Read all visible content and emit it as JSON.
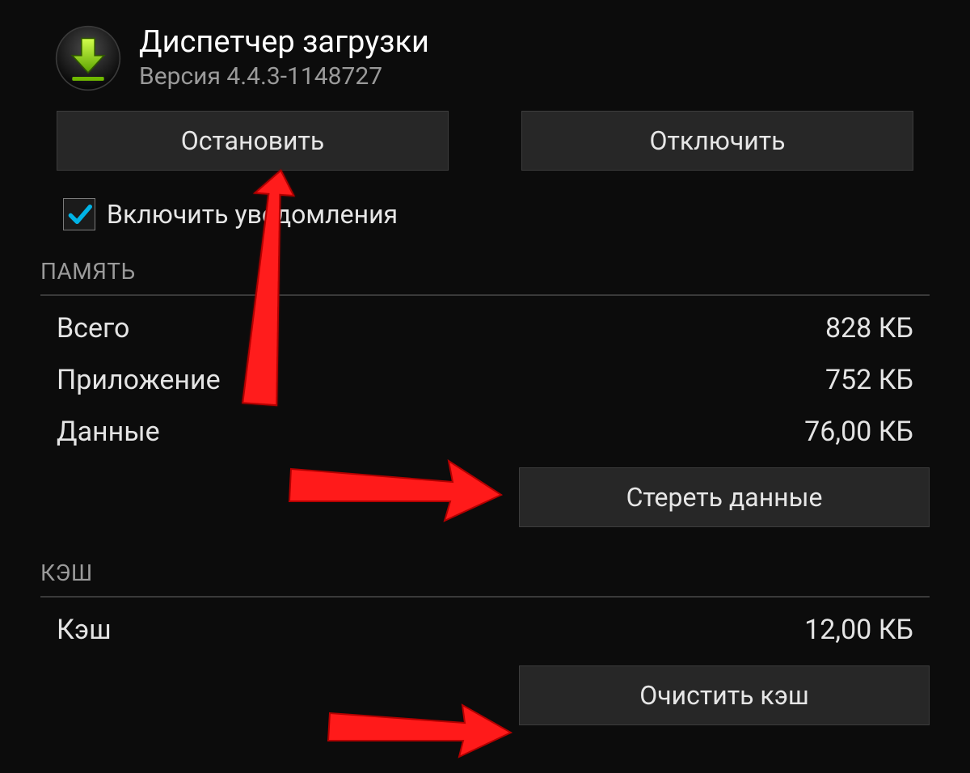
{
  "app": {
    "title": "Диспетчер загрузки",
    "version": "Версия 4.4.3-1148727"
  },
  "actions": {
    "stop": "Остановить",
    "disable": "Отключить"
  },
  "notifications": {
    "label": "Включить уведомления",
    "checked": true
  },
  "storage": {
    "header": "ПАМЯТЬ",
    "rows": {
      "total": {
        "label": "Всего",
        "value": "828 КБ"
      },
      "app": {
        "label": "Приложение",
        "value": "752 КБ"
      },
      "data": {
        "label": "Данные",
        "value": "76,00 КБ"
      }
    },
    "clear_data": "Стереть данные"
  },
  "cache": {
    "header": "КЭШ",
    "row": {
      "label": "Кэш",
      "value": "12,00 КБ"
    },
    "clear_cache": "Очистить кэш"
  },
  "annotations": {
    "color": "#ff1a1a"
  }
}
